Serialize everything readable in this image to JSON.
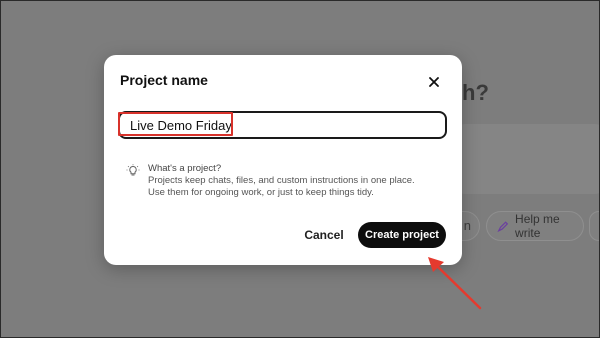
{
  "background": {
    "heading_fragment": "h?",
    "chip_partial_label": "n",
    "chip_label": "Help me write"
  },
  "modal": {
    "title": "Project name",
    "input_value": "Live Demo Friday",
    "hint_title": "What's a project?",
    "hint_body": "Projects keep chats, files, and custom instructions in one place. Use them for ongoing work, or just to keep things tidy.",
    "cancel_label": "Cancel",
    "create_label": "Create project"
  },
  "icons": {
    "close": "close-icon",
    "hint": "lightbulb-icon",
    "help_write": "pen-icon"
  },
  "colors": {
    "overlay": "#7d7d7d",
    "primary_button": "#0d0d0d",
    "annotation": "#d8322b"
  }
}
